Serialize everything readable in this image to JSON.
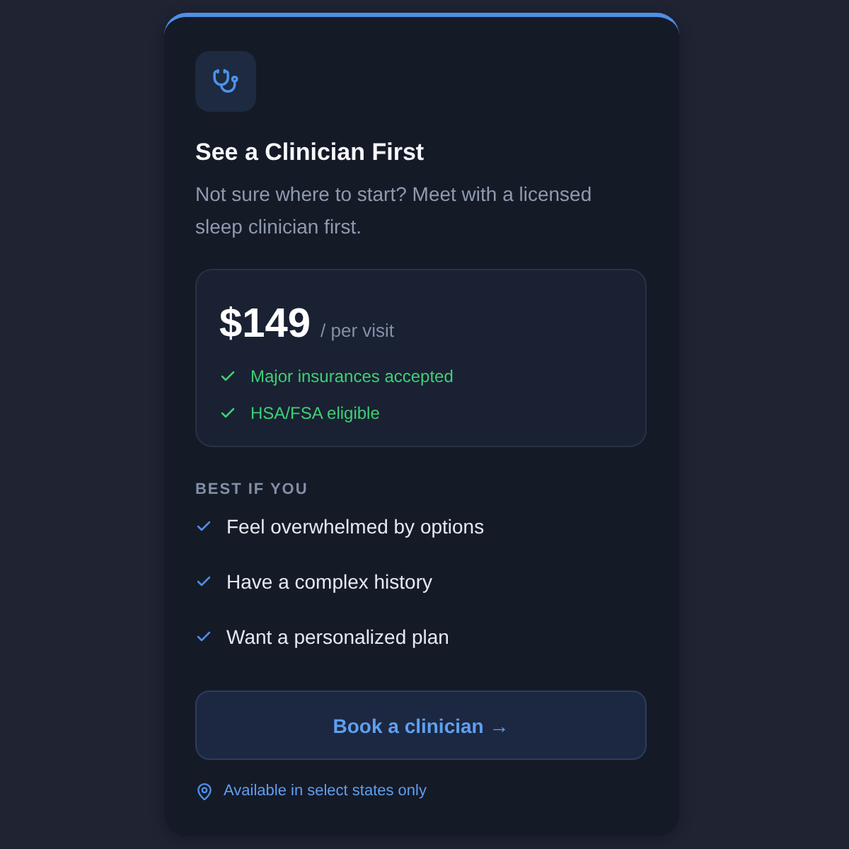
{
  "card": {
    "title": "See a Clinician First",
    "subtitle": "Not sure where to start? Meet with a licensed sleep clinician first."
  },
  "pricing": {
    "price": "$149",
    "unit": "/ per visit",
    "features": [
      "Major insurances accepted",
      "HSA/FSA eligible"
    ]
  },
  "best_for": {
    "heading": "BEST IF YOU",
    "items": [
      "Feel overwhelmed by options",
      "Have a complex history",
      "Want a personalized plan"
    ]
  },
  "button": {
    "label": "Book a clinician →"
  },
  "note": "Available in select states only"
}
